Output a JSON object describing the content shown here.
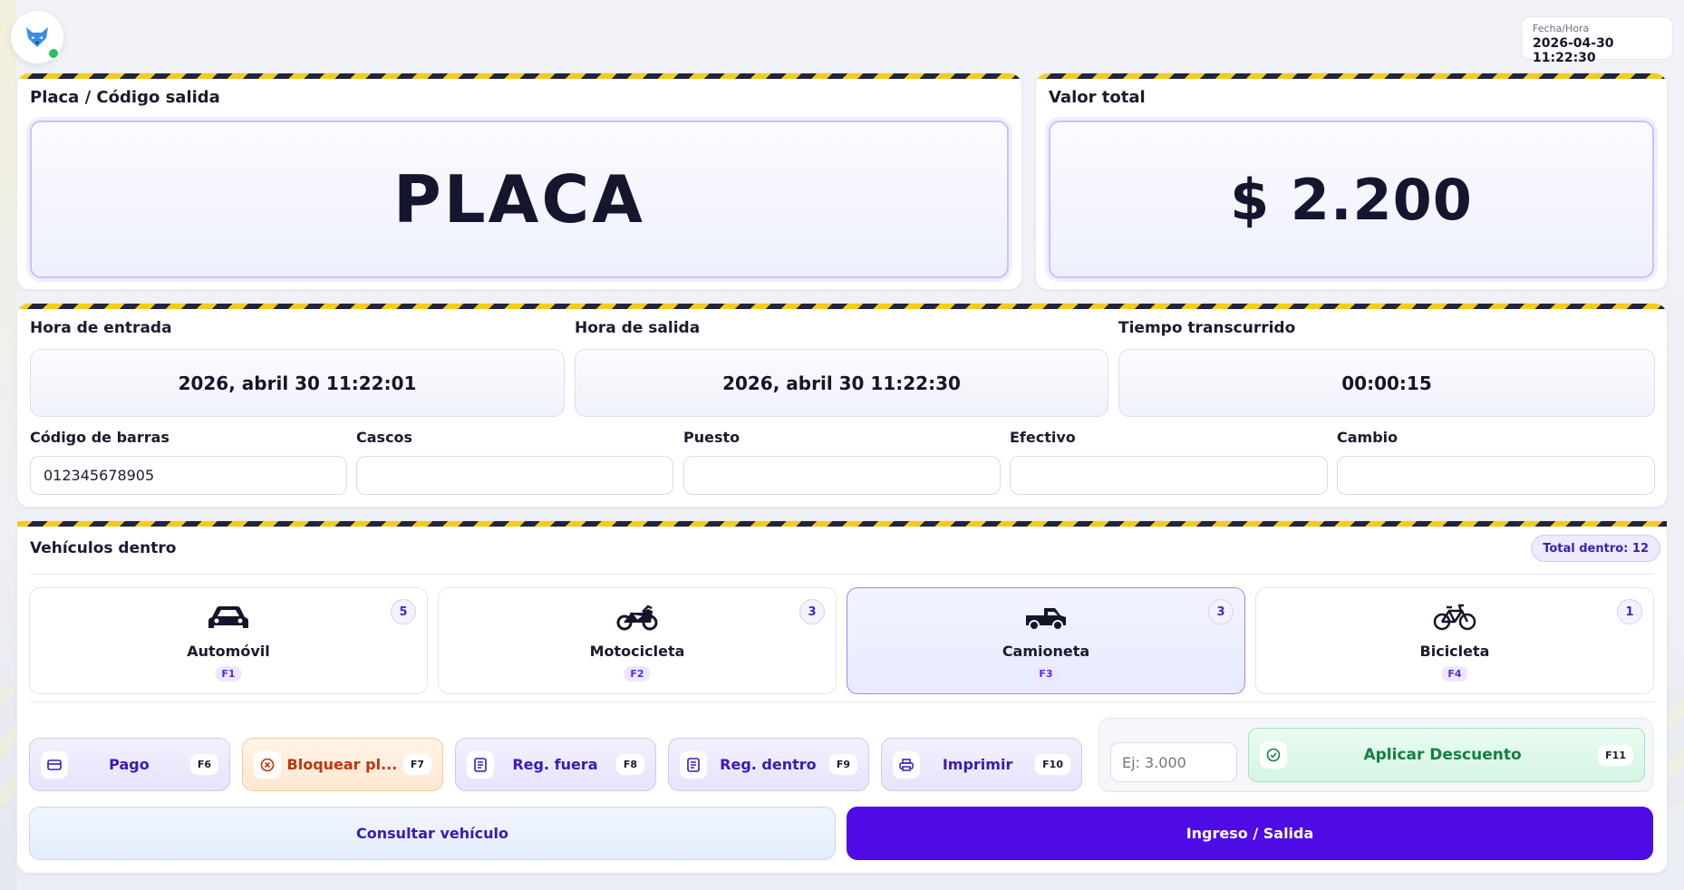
{
  "colors": {
    "accent": "#4f0be5",
    "success": "#22c55e",
    "warning_stripe": "#f2cc1d"
  },
  "header": {
    "datetime_label": "Fecha/Hora",
    "datetime_value": "2026-04-30 11:22:30"
  },
  "plate": {
    "label": "Placa / Código salida",
    "value": "PLACA"
  },
  "total": {
    "label": "Valor total",
    "value": "$ 2.200"
  },
  "times": {
    "entry_label": "Hora de entrada",
    "entry_value": "2026, abril 30 11:22:01",
    "exit_label": "Hora de salida",
    "exit_value": "2026, abril 30 11:22:30",
    "elapsed_label": "Tiempo transcurrido",
    "elapsed_value": "00:00:15"
  },
  "fields": {
    "barcode_label": "Código de barras",
    "barcode_value": "012345678905",
    "helmets_label": "Cascos",
    "helmets_value": "",
    "spot_label": "Puesto",
    "spot_value": "",
    "cash_label": "Efectivo",
    "cash_value": "",
    "change_label": "Cambio",
    "change_value": ""
  },
  "vehicles": {
    "title": "Vehículos dentro",
    "total_badge": "Total dentro: 12",
    "items": [
      {
        "name": "Automóvil",
        "key": "F1",
        "count": "5",
        "icon": "car-icon",
        "active": false
      },
      {
        "name": "Motocicleta",
        "key": "F2",
        "count": "3",
        "icon": "motorcycle-icon",
        "active": false
      },
      {
        "name": "Camioneta",
        "key": "F3",
        "count": "3",
        "icon": "pickup-truck-icon",
        "active": true
      },
      {
        "name": "Bicicleta",
        "key": "F4",
        "count": "1",
        "icon": "bicycle-icon",
        "active": false
      }
    ]
  },
  "actions": [
    {
      "label": "Pago",
      "key": "F6",
      "icon": "card-icon"
    },
    {
      "label": "Bloquear pl...",
      "key": "F7",
      "icon": "block-icon"
    },
    {
      "label": "Reg. fuera",
      "key": "F8",
      "icon": "document-icon"
    },
    {
      "label": "Reg. dentro",
      "key": "F9",
      "icon": "document-icon"
    },
    {
      "label": "Imprimir",
      "key": "F10",
      "icon": "printer-icon"
    }
  ],
  "discount": {
    "placeholder": "Ej: 3.000",
    "label": "Aplicar Descuento",
    "key": "F11",
    "icon": "check-circle-icon"
  },
  "bottom": {
    "consult_label": "Consultar vehículo",
    "main_label": "Ingreso / Salida"
  }
}
